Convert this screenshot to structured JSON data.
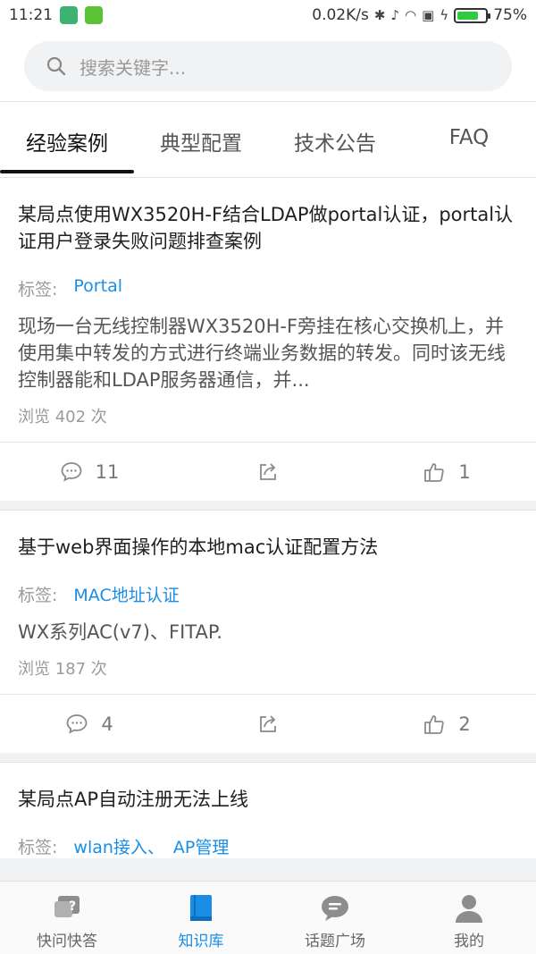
{
  "status_bar": {
    "time": "11:21",
    "net_speed": "0.02K/s",
    "battery": "75%",
    "battery_level": 0.75
  },
  "search": {
    "placeholder": "搜索关键字..."
  },
  "tabs": [
    {
      "label": "经验案例",
      "active": true
    },
    {
      "label": "典型配置",
      "active": false
    },
    {
      "label": "技术公告",
      "active": false
    },
    {
      "label": "FAQ",
      "active": false
    }
  ],
  "tags_label": "标签:",
  "cards": [
    {
      "title": "某局点使用WX3520H-F结合LDAP做portal认证，portal认证用户登录失败问题排查案例",
      "tags": [
        "Portal"
      ],
      "summary": "现场一台无线控制器WX3520H-F旁挂在核心交换机上，并使用集中转发的方式进行终端业务数据的转发。同时该无线控制器能和LDAP服务器通信，并...",
      "views": "浏览 402 次",
      "comments": "11",
      "likes": "1"
    },
    {
      "title": "基于web界面操作的本地mac认证配置方法",
      "tags": [
        "MAC地址认证"
      ],
      "summary": "WX系列AC(v7)、FITAP.",
      "views": "浏览 187 次",
      "comments": "4",
      "likes": "2"
    },
    {
      "title": "某局点AP自动注册无法上线",
      "tags": [
        "wlan接入、",
        "AP管理"
      ],
      "summary": "",
      "views": "",
      "comments": "",
      "likes": ""
    }
  ],
  "bottom_nav": [
    {
      "label": "快问快答",
      "icon": "question-icon",
      "active": false
    },
    {
      "label": "知识库",
      "icon": "book-icon",
      "active": true
    },
    {
      "label": "话题广场",
      "icon": "chat-icon",
      "active": false
    },
    {
      "label": "我的",
      "icon": "person-icon",
      "active": false
    }
  ],
  "colors": {
    "accent": "#1a8ee6",
    "battery": "#2ecc40"
  }
}
